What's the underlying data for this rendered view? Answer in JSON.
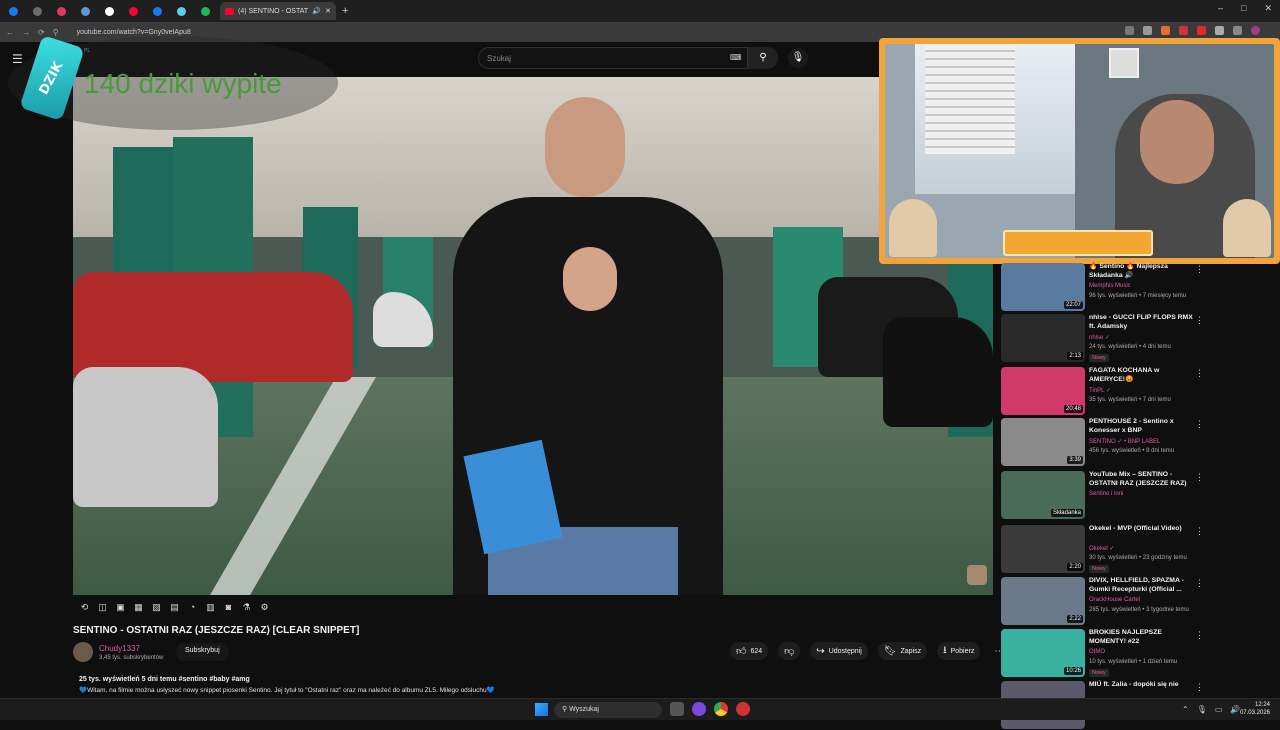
{
  "browser": {
    "active_tab_title": "(4) SENTINO - OSTATNI RAZ",
    "new_tab_label": "+",
    "url": "youtube.com/watch?v=Gny0veIApu8",
    "window_controls": [
      "–",
      "□",
      "✕"
    ],
    "tab_colors": [
      "#1877f2",
      "#6b6b6b",
      "#e23b5a",
      "#5a9ad8",
      "#ffffff",
      "#ff0033",
      "#1877f2",
      "#5ad0e0",
      "#1db954"
    ]
  },
  "youtube": {
    "search_placeholder": "Szukaj",
    "logo_region_label": "PL"
  },
  "overlay": {
    "can_label": "DZIK",
    "counter_text": "140 dziki wypite"
  },
  "video": {
    "title": "SENTINO - OSTATNI RAZ (JESZCZE RAZ) [CLEAR SNIPPET]",
    "channel_name": "Chudy1337",
    "subscribers": "3,45 tys. subskrybentów",
    "subscribe_label": "Subskrybuj",
    "likes": "624",
    "share_label": "Udostępnij",
    "save_label": "Zapisz",
    "download_label": "Pobierz",
    "views_line": "25 tys. wyświetleń  5 dni temu  #sentino #baby #amg",
    "description": "💙Witam, na filmie można usłyszeć nowy snippet piosenki Sentino. Jej tytuł to \"Ostatni raz\" oraz ma należeć do albumu ZL5. Miłego odsłuchu💙"
  },
  "recommendations": [
    {
      "title": "🔥 Sentino 🔥 Najlepsza Składanka 🔊",
      "channel": "Memphis Music",
      "meta": "96 tys. wyświetleń • 7 miesięcy temu",
      "duration": "22:07",
      "badge": "",
      "color": "#5a7aa0"
    },
    {
      "title": "nhlse - GUCCI FLIP FLOPS RMX ft. Adamsky",
      "channel": "nhlse ✓",
      "meta": "24 tys. wyświetleń • 4 dni temu",
      "duration": "2:13",
      "badge": "Nowy",
      "color": "#2a2a2a"
    },
    {
      "title": "FAGATA KOCHANA w AMERYCE!😡",
      "channel": "TinPL ✓",
      "meta": "35 tys. wyświetleń • 7 dni temu",
      "duration": "20:48",
      "badge": "",
      "color": "#d03a6a"
    },
    {
      "title": "PENTHOUSE 2 - Sentino x Konesser x BNP",
      "channel": "SENTINO ✓ • BNP LABEL",
      "meta": "456 tys. wyświetleń • 8 dni temu",
      "duration": "3:39",
      "badge": "",
      "color": "#8a8a8a"
    },
    {
      "title": "YouTube Mix – SENTINO - OSTATNI RAZ (JESZCZE RAZ) ...",
      "channel": "Sentino i inni",
      "meta": "",
      "duration": "Składanka",
      "badge": "",
      "color": "#4a6a5a"
    },
    {
      "title": "Okekel - MVP (Official Video)",
      "channel": "Okekel ✓",
      "meta": "30 tys. wyświetleń • 23 godziny temu",
      "duration": "2:20",
      "badge": "Nowy",
      "color": "#3a3a3a"
    },
    {
      "title": "DIVIX, HELLFIELD, SPAZMA - Gumki Recepturki (Official ...",
      "channel": "OrackHouse Cartel",
      "meta": "285 tys. wyświetleń • 3 tygodnie temu",
      "duration": "2:22",
      "badge": "",
      "color": "#6a7a8a"
    },
    {
      "title": "BROKIES NAJLEPSZE MOMENTY! #22",
      "channel": "OIMO",
      "meta": "10 tys. wyświetleń • 1 dzień temu",
      "duration": "10:26",
      "badge": "Nowy",
      "color": "#3ab0a0"
    },
    {
      "title": "MIÚ ft. Zalia - dopóki się nie",
      "channel": "",
      "meta": "",
      "duration": "",
      "badge": "",
      "color": "#5a5a6a"
    }
  ],
  "taskbar": {
    "search_label": "Wyszukaj",
    "time": "12:24",
    "date": "07.03.2026"
  }
}
